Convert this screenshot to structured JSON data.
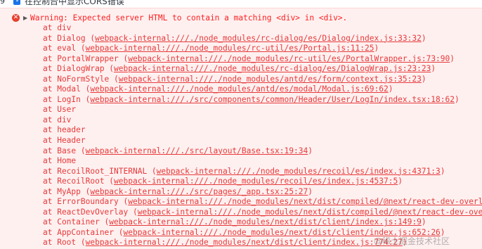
{
  "settings": {
    "cors_label": "在控制台中显示CORS错误",
    "edge_char": "9"
  },
  "error": {
    "message": "Warning: Expected server HTML to contain a matching <div> in <div>.",
    "stack": [
      {
        "text": "at div",
        "loc": ""
      },
      {
        "text": "at Dialog (",
        "loc": "webpack-internal:///./node_modules/rc-dialog/es/Dialog/index.js:33:32"
      },
      {
        "text": "at eval (",
        "loc": "webpack-internal:///./node_modules/rc-util/es/Portal.js:11:25"
      },
      {
        "text": "at PortalWrapper (",
        "loc": "webpack-internal:///./node_modules/rc-util/es/PortalWrapper.js:73:90"
      },
      {
        "text": "at DialogWrap (",
        "loc": "webpack-internal:///./node_modules/rc-dialog/es/DialogWrap.js:23:23"
      },
      {
        "text": "at NoFormStyle (",
        "loc": "webpack-internal:///./node_modules/antd/es/form/context.js:35:23"
      },
      {
        "text": "at Modal (",
        "loc": "webpack-internal:///./node_modules/antd/es/modal/Modal.js:69:62"
      },
      {
        "text": "at LogIn (",
        "loc": "webpack-internal:///./src/components/common/Header/User/LogIn/index.tsx:18:62"
      },
      {
        "text": "at User",
        "loc": ""
      },
      {
        "text": "at div",
        "loc": ""
      },
      {
        "text": "at header",
        "loc": ""
      },
      {
        "text": "at Header",
        "loc": ""
      },
      {
        "text": "at Base (",
        "loc": "webpack-internal:///./src/layout/Base.tsx:19:34"
      },
      {
        "text": "at Home",
        "loc": ""
      },
      {
        "text": "at RecoilRoot_INTERNAL (",
        "loc": "webpack-internal:///./node_modules/recoil/es/index.js:4371:3"
      },
      {
        "text": "at RecoilRoot (",
        "loc": "webpack-internal:///./node_modules/recoil/es/index.js:4537:5"
      },
      {
        "text": "at MyApp (",
        "loc": "webpack-internal:///./src/pages/_app.tsx:25:27"
      },
      {
        "text": "at ErrorBoundary (",
        "loc": "webpack-internal:///./node_modules/next/dist/compiled/@next/react-dev-overlay"
      },
      {
        "text": "at ReactDevOverlay (",
        "loc": "webpack-internal:///./node_modules/next/dist/compiled/@next/react-dev-overl"
      },
      {
        "text": "at Container (",
        "loc": "webpack-internal:///./node_modules/next/dist/client/index.js:149:9"
      },
      {
        "text": "at AppContainer (",
        "loc": "webpack-internal:///./node_modules/next/dist/client/index.js:652:26"
      },
      {
        "text": "at Root (",
        "loc": "webpack-internal:///./node_modules/next/dist/client/index.js:774:27"
      }
    ]
  },
  "watermark": "@稀土掘金技术社区",
  "colors": {
    "error_text": "#fc1f1f",
    "error_background": "#fff0f0",
    "error_icon": "#e8402f",
    "checkbox": "#1a73e8"
  }
}
